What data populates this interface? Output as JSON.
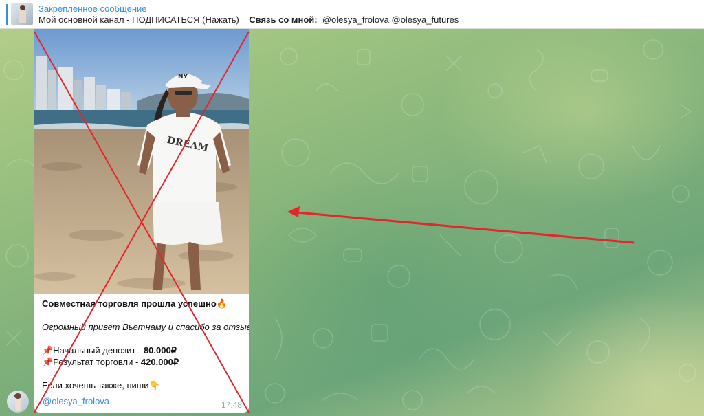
{
  "pinned": {
    "title": "Закреплённое сообщение",
    "text_main": "Мой основной канал - ПОДПИСАТЬСЯ (Нажать)",
    "contact_label": "Связь со мной:",
    "contact_handles": "@olesya_frolova @olesya_futures"
  },
  "message": {
    "caption": {
      "title": "Совместная торговля прошла успешно🔥",
      "thanks": "Огромный привет Вьетнаму и спасибо за отзыв❤️",
      "deposit_label": "📌Начальный депозит - ",
      "deposit_value": "80.000₽",
      "result_label": "📌Результат торговли - ",
      "result_value": "420.000₽",
      "cta": "Если хочешь также, пиши👇"
    },
    "author": "@olesya_frolova",
    "time": "17:48",
    "photo_tshirt_text": "DREAM",
    "photo_cap_logo": "NY"
  },
  "colors": {
    "accent": "#3a8fd6",
    "annotation_red": "#e3262b"
  }
}
